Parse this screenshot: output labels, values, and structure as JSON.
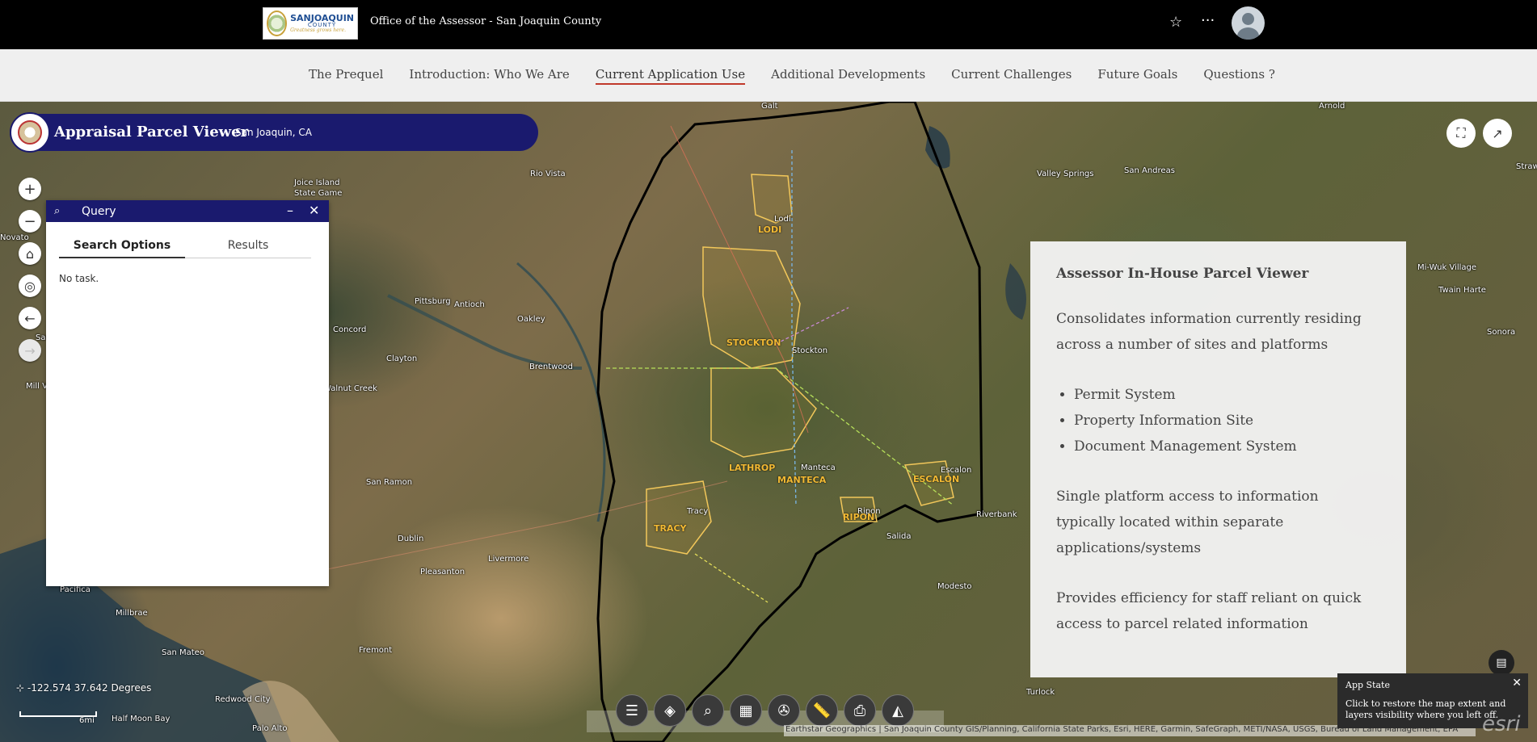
{
  "header": {
    "logo_text_main": "SANJOAQUIN",
    "logo_text_county": "COUNTY",
    "logo_tagline": "Greatness grows here.",
    "site_title": "Office of the Assessor - San Joaquin County",
    "icons": [
      "star-icon",
      "more-icon",
      "avatar"
    ]
  },
  "nav": {
    "items": [
      {
        "label": "The Prequel"
      },
      {
        "label": "Introduction: Who We Are"
      },
      {
        "label": "Current Application Use",
        "active": true
      },
      {
        "label": "Additional Developments"
      },
      {
        "label": "Current Challenges"
      },
      {
        "label": "Future Goals"
      },
      {
        "label": "Questions ?"
      }
    ]
  },
  "app": {
    "title": "Appraisal Parcel Viewer",
    "subtitle": "San Joaquin, CA"
  },
  "map_controls": {
    "zoom_in": "+",
    "zoom_out": "−",
    "home": "⌂",
    "locate": "◎",
    "back": "←",
    "forward": "→"
  },
  "query_panel": {
    "title": "Query",
    "tabs": [
      {
        "label": "Search Options",
        "active": true
      },
      {
        "label": "Results"
      }
    ],
    "empty_text": "No task."
  },
  "card": {
    "heading": "Assessor In-House Parcel Viewer",
    "para1": "Consolidates information currently residing across a number of sites and platforms",
    "bullets": [
      "Permit System",
      "Property Information Site",
      "Document Management System"
    ],
    "para2": "Single platform access to information typically located within separate applications/systems",
    "para3": "Provides efficiency for staff reliant on quick access to parcel related information"
  },
  "map_labels": {
    "places": [
      "Galt",
      "Arnold",
      "Valley Springs",
      "San Andreas",
      "Joice Island",
      "State Game",
      "Rio Vista",
      "Lodi",
      "Pittsburg",
      "Antioch",
      "Oakley",
      "Concord",
      "Clayton",
      "Brentwood",
      "Stockton",
      "Walnut Creek",
      "San Ramon",
      "Dublin",
      "Pleasanton",
      "Livermore",
      "Tracy",
      "Manteca",
      "Escalon",
      "Riverbank",
      "Ripon",
      "Salida",
      "Modesto",
      "Pacifica",
      "Millbrae",
      "San Mateo",
      "Fremont",
      "Redwood City",
      "Half Moon Bay",
      "Palo Alto",
      "Turlock",
      "Mi-Wuk Village",
      "Twain Harte",
      "Novato",
      "Strawberry",
      "Mill Valley",
      "Sausalito",
      "Sonora"
    ],
    "cities": [
      "LODI",
      "STOCKTON",
      "LATHROP",
      "MANTECA",
      "ESCALON",
      "TRACY",
      "RIPON"
    ]
  },
  "status": {
    "coordinates": "-122.574 37.642 Degrees",
    "scale": "6mi",
    "attribution": "Earthstar Geographics | San Joaquin County GIS/Planning, California State Parks, Esri, HERE, Garmin, SafeGraph, METI/NASA, USGS, Bureau of Land Management, EPA"
  },
  "app_state": {
    "title": "App State",
    "desc": "Click to restore the map extent and layers visibility where you left off."
  },
  "toolbar": [
    "legend-icon",
    "layers-icon",
    "query-icon",
    "basemap-gallery-icon",
    "analysis-icon",
    "measure-icon",
    "print-icon",
    "about-icon"
  ],
  "colors": {
    "app_bar": "#1a1a6e",
    "nav_active_underline": "#c0392b",
    "city_label": "#f2b933",
    "county_boundary": "#000000"
  }
}
